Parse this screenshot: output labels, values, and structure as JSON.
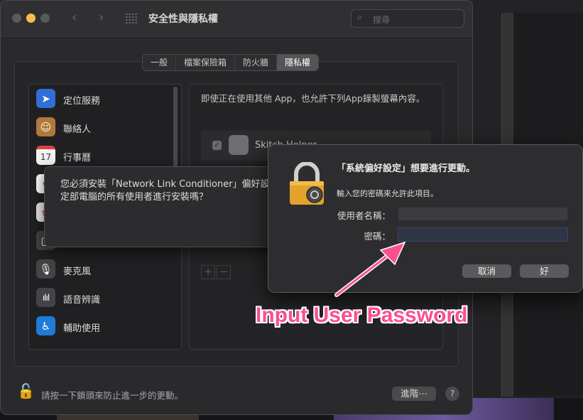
{
  "window": {
    "title": "安全性與隱私權",
    "search_placeholder": "搜尋"
  },
  "tabs": [
    {
      "label": "一般",
      "active": false
    },
    {
      "label": "檔案保險箱",
      "active": false
    },
    {
      "label": "防火牆",
      "active": false
    },
    {
      "label": "隱私權",
      "active": true
    }
  ],
  "sidebar": {
    "items": [
      {
        "label": "定位服務",
        "icon": "location-arrow-icon",
        "color": "#2f6fd6"
      },
      {
        "label": "聯絡人",
        "icon": "contacts-book-icon",
        "color": "#b07a3a"
      },
      {
        "label": "行事曆",
        "icon": "calendar-icon",
        "color": "#f2f2f2",
        "icon_text": "17"
      },
      {
        "label": "",
        "icon": "reminders-icon",
        "color": "#ffffff"
      },
      {
        "label": "",
        "icon": "photos-icon",
        "color": "#e8e8e8"
      },
      {
        "label": "",
        "icon": "camera-icon",
        "color": "#444446"
      },
      {
        "label": "麥克風",
        "icon": "microphone-icon",
        "color": "#444446"
      },
      {
        "label": "語音辨識",
        "icon": "waveform-icon",
        "color": "#444446"
      },
      {
        "label": "輔助使用",
        "icon": "accessibility-icon",
        "color": "#1e7bd8"
      }
    ]
  },
  "right_panel": {
    "description": "即使正在使用其他 App，也允許下列App錄製螢幕內容。",
    "apps": [
      {
        "name": "Skitch Helper",
        "checked": true
      }
    ],
    "add_label": "+",
    "remove_label": "−"
  },
  "footer": {
    "lock_text": "請按一下鎖頭來防止進一步的更動。",
    "advanced_label": "進階⋯",
    "help_label": "?"
  },
  "install_sheet": {
    "text": "您必須安裝「Network Link Conditioner」偏好設定部電腦的所有使用者進行安裝嗎？"
  },
  "auth_dialog": {
    "title": "「系統偏好設定」想要進行更動。",
    "subtitle": "輸入您的密碼來允許此項目。",
    "username_label": "使用者名稱：",
    "username_value": "",
    "password_label": "密碼：",
    "password_value": "",
    "cancel_label": "取消",
    "ok_label": "好"
  },
  "annotation": {
    "text": "Input User Password",
    "color": "#fb4f8f"
  }
}
